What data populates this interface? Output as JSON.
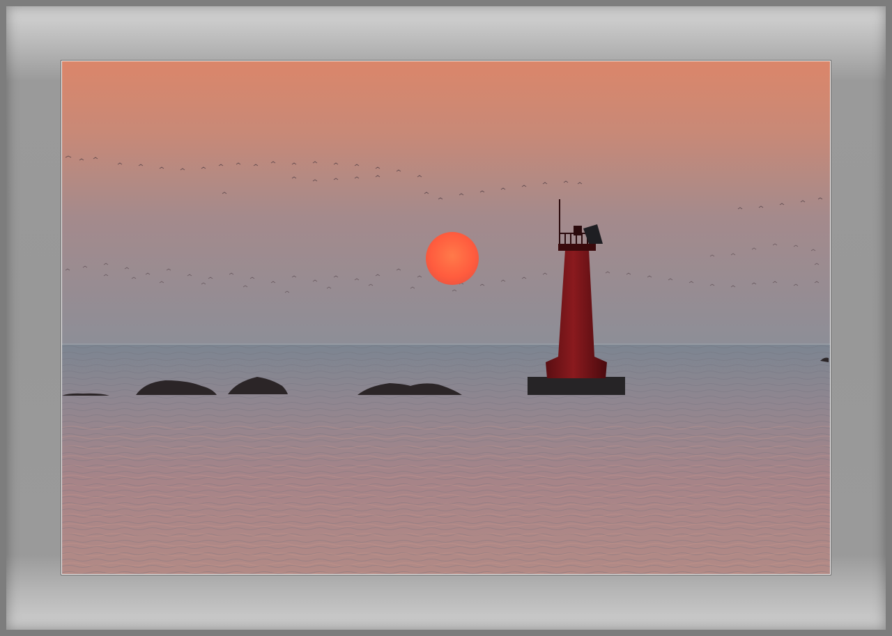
{
  "scene": {
    "colors": {
      "frame": "#9a9a9a",
      "sky_top": "#d9866a",
      "sky_mid": "#b48b86",
      "sky_horizon": "#8f8f96",
      "sun": "#ff5a3c",
      "sea_far": "#7e8590",
      "sea_near": "#b58580",
      "lighthouse": "#7a1418",
      "rock": "#2a2426"
    }
  }
}
